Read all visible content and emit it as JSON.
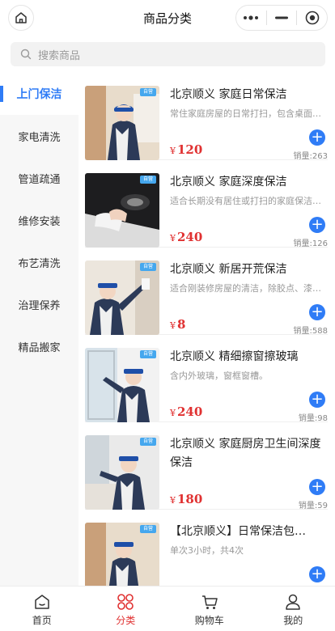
{
  "header": {
    "title": "商品分类"
  },
  "search": {
    "placeholder": "搜索商品"
  },
  "sidebar": {
    "items": [
      {
        "label": "上门保洁",
        "active": true
      },
      {
        "label": "家电清洗",
        "active": false
      },
      {
        "label": "管道疏通",
        "active": false
      },
      {
        "label": "维修安装",
        "active": false
      },
      {
        "label": "布艺清洗",
        "active": false
      },
      {
        "label": "治理保养",
        "active": false
      },
      {
        "label": "精品搬家",
        "active": false
      }
    ]
  },
  "products": [
    {
      "title": "北京顺义 家庭日常保洁",
      "desc": "常住家庭房屋的日常打扫，包含桌面…",
      "currency": "¥",
      "price": "120",
      "sales": "销量:263",
      "tag": "自营"
    },
    {
      "title": "北京顺义 家庭深度保洁",
      "desc": "适合长期没有居住或打扫的家庭保洁…",
      "currency": "¥",
      "price": "240",
      "sales": "销量:126",
      "tag": "自营"
    },
    {
      "title": "北京顺义 新居开荒保洁",
      "desc": "适合刚装修房屋的清洁，除胶点、漆…",
      "currency": "¥",
      "price": "8",
      "sales": "销量:588",
      "tag": "自营"
    },
    {
      "title": "北京顺义 精细擦窗擦玻璃",
      "desc": "含内外玻璃，窗框窗槽。",
      "currency": "¥",
      "price": "240",
      "sales": "销量:98",
      "tag": "自营"
    },
    {
      "title": "北京顺义 家庭厨房卫生间深度保洁",
      "desc": "",
      "currency": "¥",
      "price": "180",
      "sales": "销量:59",
      "tag": "自营"
    },
    {
      "title": "【北京顺义】日常保洁包…",
      "desc": "单次3小时，共4次",
      "currency": "",
      "price": "",
      "sales": "",
      "tag": "自营"
    }
  ],
  "tabbar": {
    "items": [
      {
        "label": "首页",
        "icon": "home-icon",
        "active": false
      },
      {
        "label": "分类",
        "icon": "category-icon",
        "active": true
      },
      {
        "label": "购物车",
        "icon": "cart-icon",
        "active": false
      },
      {
        "label": "我的",
        "icon": "user-icon",
        "active": false
      }
    ]
  },
  "colors": {
    "accent": "#2f7cf6",
    "price": "#e03131",
    "active_tab": "#e03131"
  }
}
